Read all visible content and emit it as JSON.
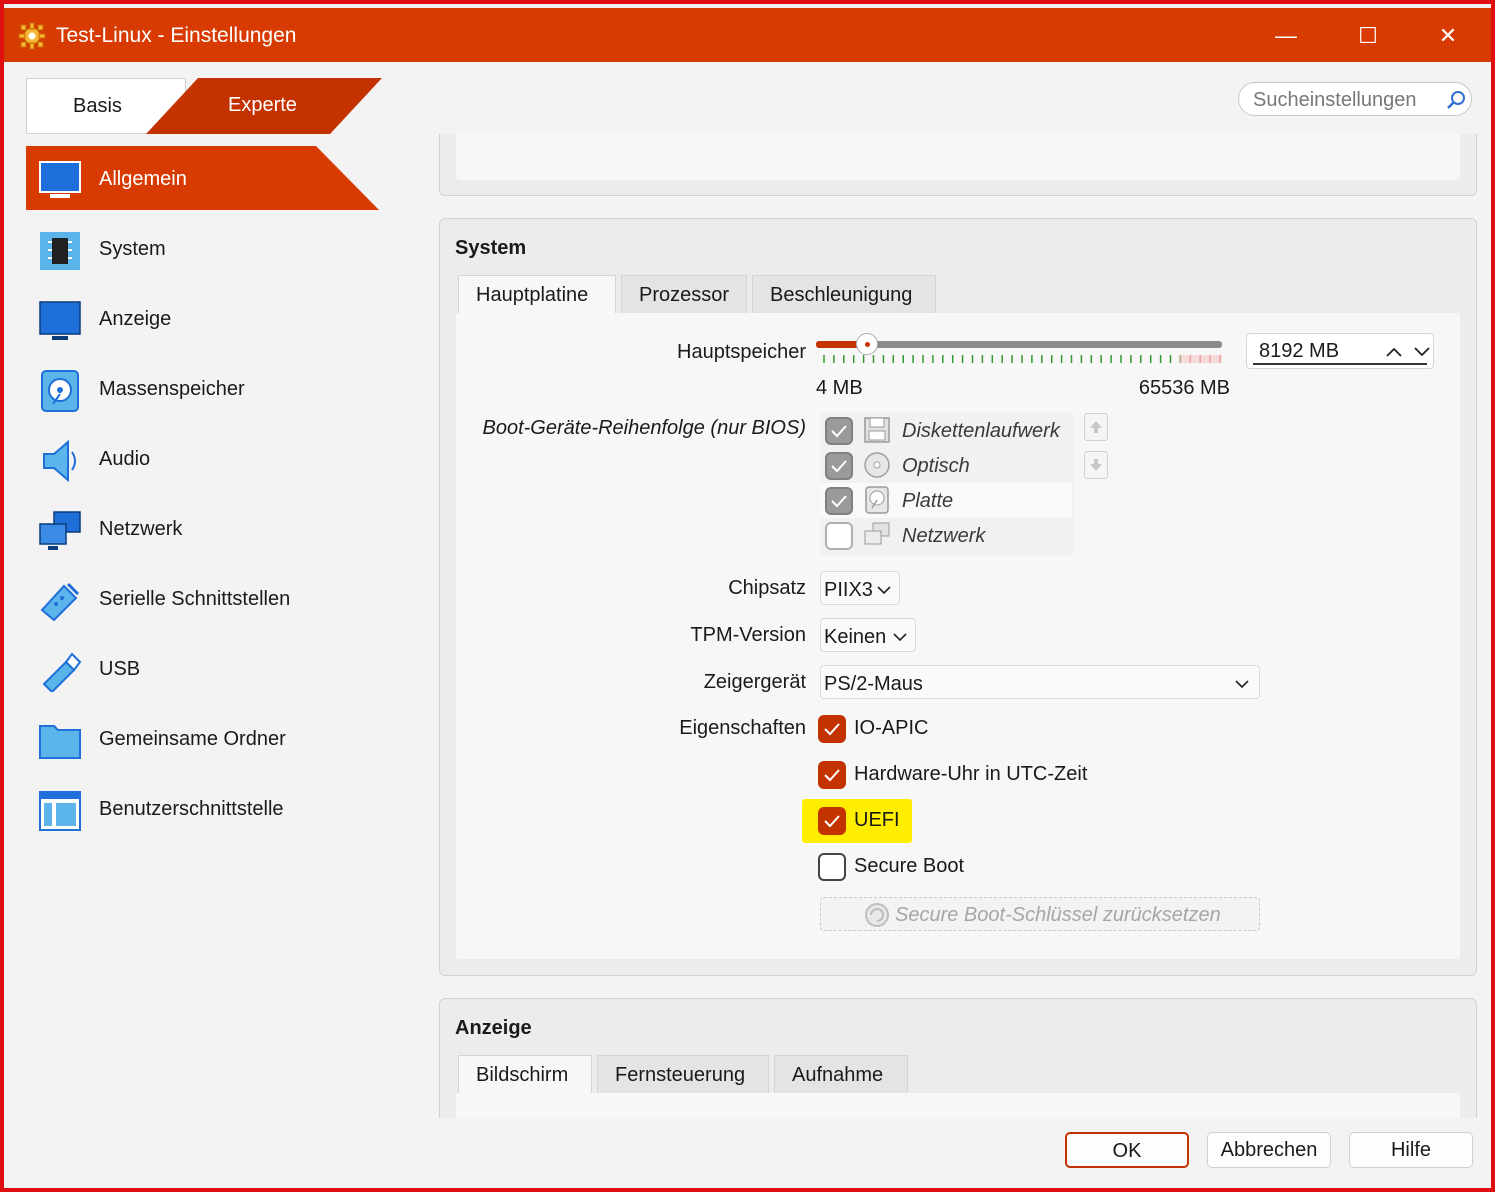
{
  "window": {
    "title": "Test-Linux - Einstellungen",
    "controls": {
      "minimize": "—",
      "maximize": "☐",
      "close": "✕"
    }
  },
  "mode": {
    "basis_label": "Basis",
    "experte_label": "Experte",
    "selected": "Experte"
  },
  "search": {
    "placeholder": "Sucheinstellungen"
  },
  "sidebar": {
    "items": [
      {
        "label": "Allgemein",
        "icon": "monitor-icon",
        "active": true
      },
      {
        "label": "System",
        "icon": "chip-icon",
        "active": false
      },
      {
        "label": "Anzeige",
        "icon": "display-icon",
        "active": false
      },
      {
        "label": "Massenspeicher",
        "icon": "disk-icon",
        "active": false
      },
      {
        "label": "Audio",
        "icon": "speaker-icon",
        "active": false
      },
      {
        "label": "Netzwerk",
        "icon": "network-icon",
        "active": false
      },
      {
        "label": "Serielle Schnittstellen",
        "icon": "serial-port-icon",
        "active": false
      },
      {
        "label": "USB",
        "icon": "usb-icon",
        "active": false
      },
      {
        "label": "Gemeinsame Ordner",
        "icon": "folder-icon",
        "active": false
      },
      {
        "label": "Benutzerschnittstelle",
        "icon": "ui-layout-icon",
        "active": false
      }
    ]
  },
  "system": {
    "title": "System",
    "tabs": [
      "Hauptplatine",
      "Prozessor",
      "Beschleunigung"
    ],
    "active_tab": "Hauptplatine",
    "memory": {
      "label": "Hauptspeicher",
      "value": "8192 MB",
      "min_label": "4 MB",
      "max_label": "65536 MB",
      "fraction": 0.125
    },
    "boot_order": {
      "label": "Boot-Geräte-Reihenfolge (nur BIOS)",
      "devices": [
        {
          "label": "Diskettenlaufwerk",
          "checked": true,
          "icon": "floppy-icon"
        },
        {
          "label": "Optisch",
          "checked": true,
          "icon": "optical-disc-icon"
        },
        {
          "label": "Platte",
          "checked": true,
          "icon": "hard-disk-icon"
        },
        {
          "label": "Netzwerk",
          "checked": false,
          "icon": "network-icon"
        }
      ]
    },
    "chipset": {
      "label": "Chipsatz",
      "value": "PIIX3"
    },
    "tpm": {
      "label": "TPM-Version",
      "value": "Keinen"
    },
    "pointer": {
      "label": "Zeigergerät",
      "value": "PS/2-Maus"
    },
    "features": {
      "label": "Eigenschaften",
      "io_apic": {
        "label": "IO-APIC",
        "checked": true
      },
      "utc": {
        "label": "Hardware-Uhr in UTC-Zeit",
        "checked": true
      },
      "uefi": {
        "label": "UEFI",
        "checked": true,
        "highlighted": true
      },
      "secure_boot": {
        "label": "Secure Boot",
        "checked": false
      }
    },
    "reset_keys_label": "Secure Boot-Schlüssel zurücksetzen"
  },
  "anzeige": {
    "title": "Anzeige",
    "tabs": [
      "Bildschirm",
      "Fernsteuerung",
      "Aufnahme"
    ],
    "active_tab": "Bildschirm"
  },
  "footer": {
    "ok": "OK",
    "cancel": "Abbrechen",
    "help": "Hilfe"
  },
  "colors": {
    "accent": "#d83b01",
    "highlight": "#ffee00",
    "frame": "#e01010"
  }
}
